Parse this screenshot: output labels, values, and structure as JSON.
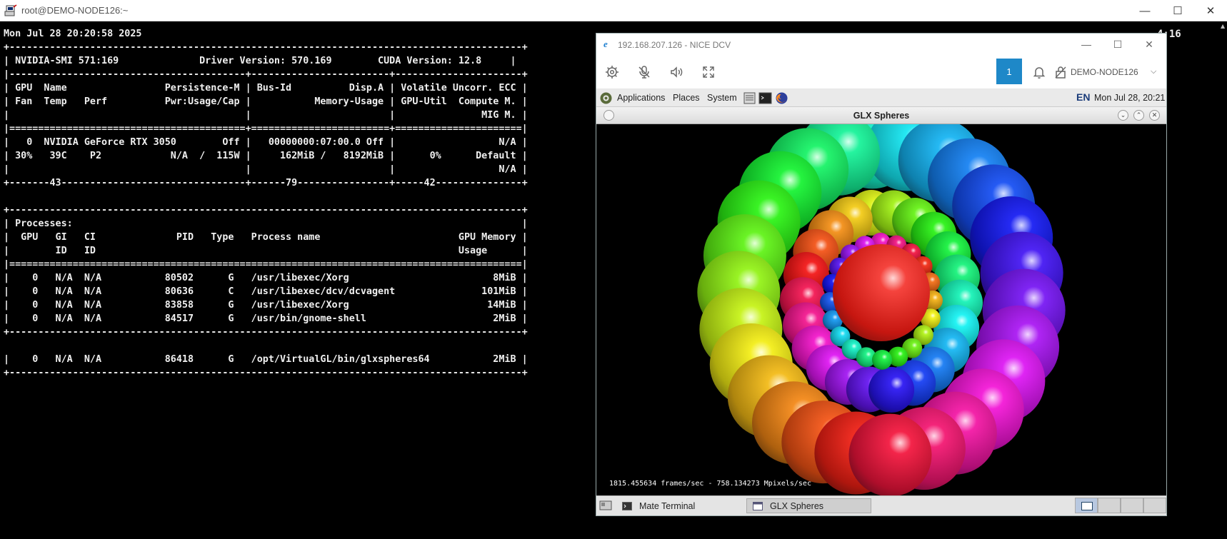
{
  "outer_window": {
    "title": "root@DEMO-NODE126:~",
    "minimize_glyph": "—",
    "maximize_glyph": "☐",
    "close_glyph": "✕",
    "icon": "putty-icon"
  },
  "terminal": {
    "lines": [
      "Mon Jul 28 20:20:58 2025",
      "+-----------------------------------------------------------------------------------------+",
      "| NVIDIA-SMI 571:169              Driver Version: 570.169        CUDA Version: 12.8     |",
      "|-----------------------------------------+------------------------+----------------------+",
      "| GPU  Name                 Persistence-M | Bus-Id          Disp.A | Volatile Uncorr. ECC |",
      "| Fan  Temp   Perf          Pwr:Usage/Cap |           Memory-Usage | GPU-Util  Compute M. |",
      "|                                         |                        |               MIG M. |",
      "|=========================================+========================+======================|",
      "|   0  NVIDIA GeForce RTX 3050        Off |   00000000:07:00.0 Off |                  N/A |",
      "| 30%   39C    P2            N/A  /  115W |     162MiB /   8192MiB |      0%      Default |",
      "|                                         |                        |                  N/A |",
      "+-------43--------------------------------+------79----------------+-----42---------------+",
      "",
      "+-----------------------------------------------------------------------------------------+",
      "| Processes:                                                                              |",
      "|  GPU   GI   CI              PID   Type   Process name                        GPU Memory |",
      "|        ID   ID                                                               Usage      |",
      "|=========================================================================================|",
      "|    0   N/A  N/A           80502      G   /usr/libexec/Xorg                         8MiB |",
      "|    0   N/A  N/A           80636      C   /usr/libexec/dcv/dcvagent               101MiB |",
      "|    0   N/A  N/A           83858      G   /usr/libexec/Xorg                        14MiB |",
      "|    0   N/A  N/A           84517      G   /usr/bin/gnome-shell                      2MiB |",
      "+-----------------------------------------------------------------------------------------+",
      "",
      "|    0   N/A  N/A           86418      G   /opt/VirtualGL/bin/glxspheres64           2MiB |",
      "+-----------------------------------------------------------------------------------------+"
    ],
    "clock_fragment": "4:16"
  },
  "dcv": {
    "title": "192.168.207.126 - NICE DCV",
    "minimize_glyph": "—",
    "maximize_glyph": "☐",
    "close_glyph": "✕",
    "session_number": "1",
    "host": "DEMO-NODE126",
    "chevron": "⌵"
  },
  "mate_panel": {
    "applications": "Applications",
    "places": "Places",
    "system": "System",
    "language": "EN",
    "clock": "Mon Jul 28, 20:21"
  },
  "glx": {
    "title": "GLX Spheres",
    "fps": "1815.455634 frames/sec - 758.134273 Mpixels/sec",
    "btn_minimize": "⌄",
    "btn_maximize": "⌃",
    "btn_close": "✕"
  },
  "taskbar": {
    "terminal_label": "Mate Terminal",
    "glx_label": "GLX Spheres"
  }
}
